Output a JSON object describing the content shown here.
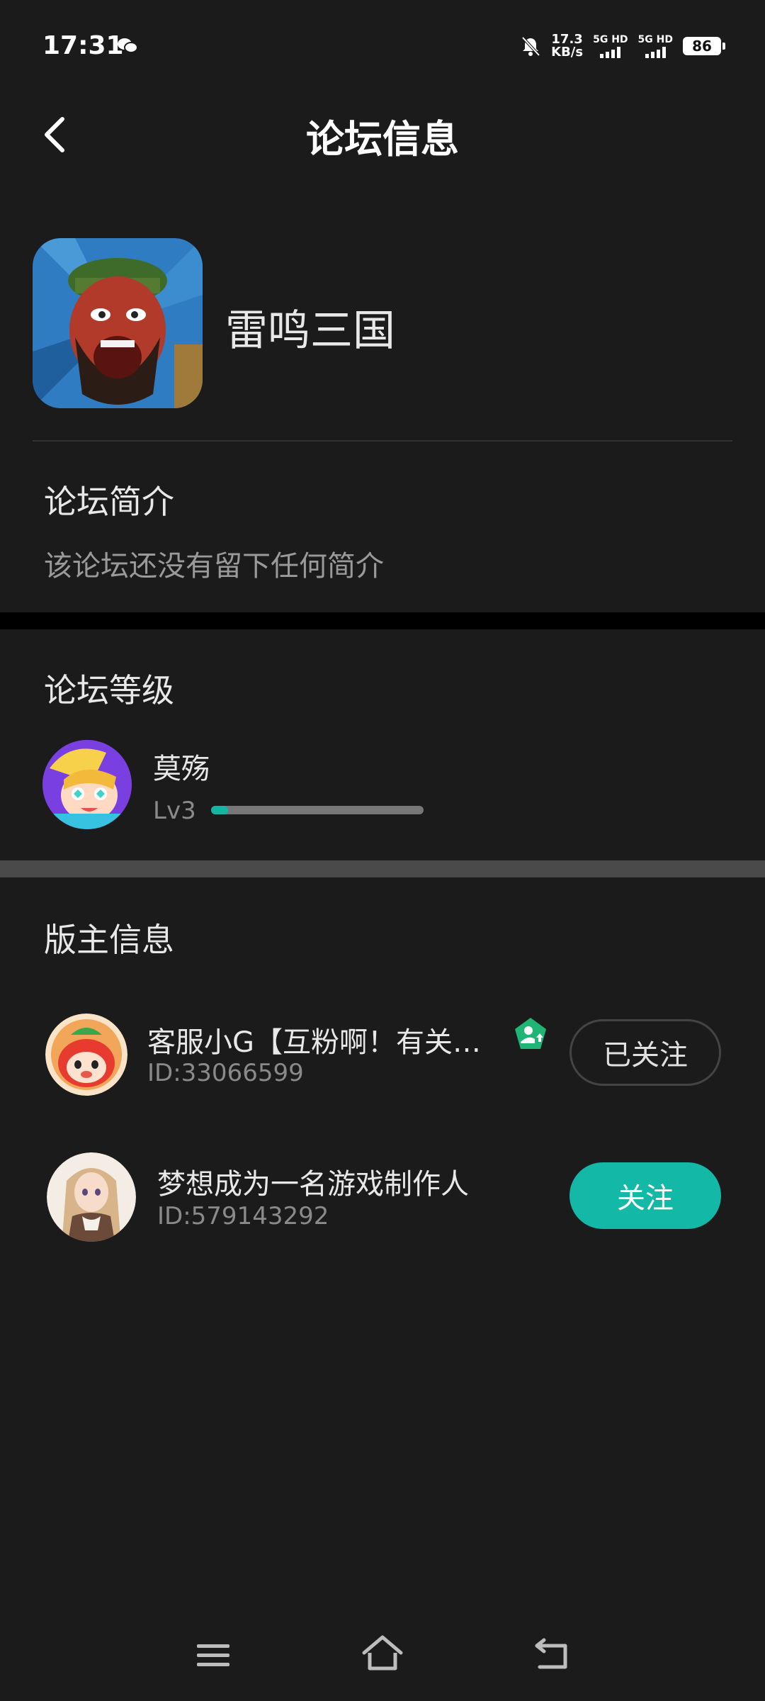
{
  "status_bar": {
    "time": "17:31",
    "speed_value": "17.3",
    "speed_unit": "KB/s",
    "sim1": "5G HD",
    "sim2": "5G HD",
    "battery": "86"
  },
  "header": {
    "title": "论坛信息",
    "back_icon": "chevron-left-icon"
  },
  "game": {
    "name": "雷鸣三国"
  },
  "intro": {
    "title": "论坛简介",
    "text": "该论坛还没有留下任何简介"
  },
  "level": {
    "title": "论坛等级",
    "user_name": "莫殇",
    "level_label": "Lv3",
    "progress": 0.08,
    "progress_color": "#17b5a1"
  },
  "moderators": {
    "title": "版主信息",
    "items": [
      {
        "name": "客服小G【互粉啊！有关…",
        "id": "ID:33066599",
        "button": "已关注",
        "badge_icon": "moderator-badge-icon"
      },
      {
        "name": "梦想成为一名游戏制作人",
        "id": "ID:579143292",
        "button": "关注"
      }
    ]
  },
  "colors": {
    "accent": "#14b8a6",
    "background": "#1b1b1b"
  },
  "navbar": {
    "icons": [
      "menu-icon",
      "home-icon",
      "back-icon"
    ]
  }
}
